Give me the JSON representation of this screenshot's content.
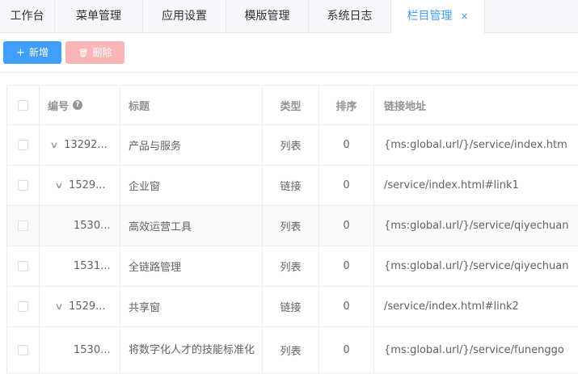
{
  "tabs": [
    {
      "label": "工作台",
      "active": false
    },
    {
      "label": "菜单管理",
      "active": false
    },
    {
      "label": "应用设置",
      "active": false
    },
    {
      "label": "模版管理",
      "active": false
    },
    {
      "label": "系统日志",
      "active": false
    },
    {
      "label": "栏目管理",
      "active": true,
      "close": "×"
    }
  ],
  "toolbar": {
    "add_icon": "+",
    "add_label": "新增",
    "delete_icon": "🗑",
    "delete_label": "删除"
  },
  "table": {
    "headers": {
      "id": "编号",
      "help_icon": "?",
      "title": "标题",
      "type": "类型",
      "sort": "排序",
      "link": "链接地址"
    },
    "rows": [
      {
        "id": "13292...",
        "title": "产品与服务",
        "type": "列表",
        "sort": "0",
        "link": "{ms:global.url/}/service/index.htm",
        "expand": "∨"
      },
      {
        "id": "1529...",
        "title": "企业窗",
        "type": "链接",
        "sort": "0",
        "link": "/service/index.html#link1",
        "expand": "∨"
      },
      {
        "id": "1530...",
        "title": "高效运营工具",
        "type": "列表",
        "sort": "0",
        "link": "{ms:global.url/}/service/qiyechuan",
        "expand": ""
      },
      {
        "id": "1531...",
        "title": "全链路管理",
        "type": "列表",
        "sort": "0",
        "link": "{ms:global.url/}/service/qiyechuan",
        "expand": ""
      },
      {
        "id": "1529...",
        "title": "共享窗",
        "type": "链接",
        "sort": "0",
        "link": "/service/index.html#link2",
        "expand": "∨"
      },
      {
        "id": "1530...",
        "title": "将数字化人才的技能标准化",
        "type": "列表",
        "sort": "0",
        "link": "{ms:global.url/}/service/funenggo",
        "expand": ""
      }
    ]
  },
  "colors": {
    "primary": "#409eff",
    "danger_disabled": "#fab6b6"
  }
}
